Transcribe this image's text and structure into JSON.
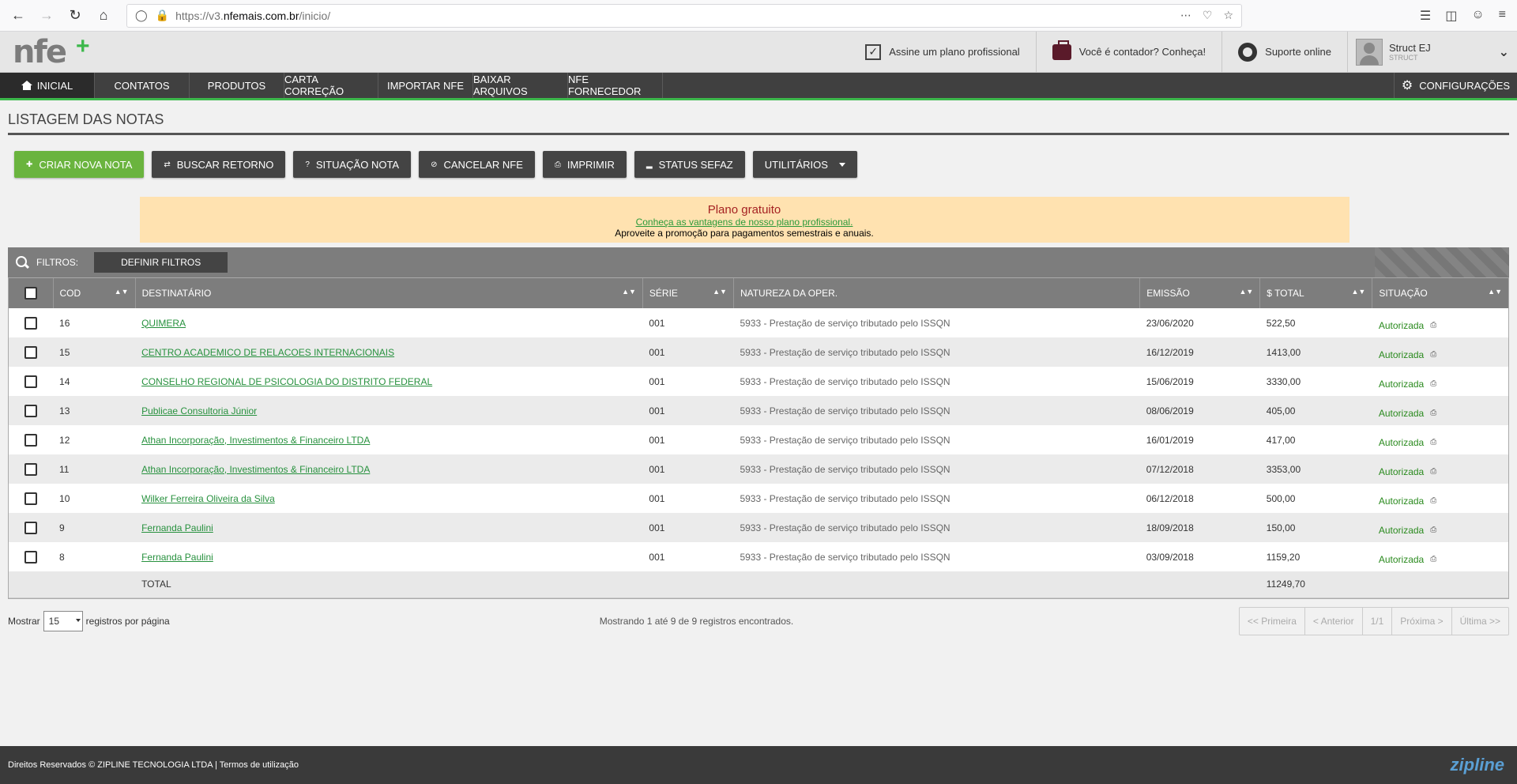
{
  "browser": {
    "url_prefix": "https://v3.",
    "url_domain": "nfemais.com.br",
    "url_path": "/inicio/"
  },
  "header": {
    "plan": "Assine um plano profissional",
    "accountant": "Você é contador? Conheça!",
    "support": "Suporte online",
    "user_name": "Struct EJ",
    "user_sub": "STRUCT"
  },
  "nav": {
    "items": [
      "INICIAL",
      "CONTATOS",
      "PRODUTOS",
      "CARTA CORREÇÃO",
      "IMPORTAR NFE",
      "BAIXAR ARQUIVOS",
      "NFE FORNECEDOR"
    ],
    "config": "CONFIGURAÇÕES"
  },
  "page_title": "LISTAGEM DAS NOTAS",
  "actions": {
    "create": "CRIAR NOVA NOTA",
    "fetch": "BUSCAR RETORNO",
    "status_note": "SITUAÇÃO NOTA",
    "cancel": "CANCELAR NFE",
    "print": "IMPRIMIR",
    "sefaz": "STATUS SEFAZ",
    "utils": "UTILITÁRIOS"
  },
  "promo": {
    "title": "Plano gratuito",
    "link": "Conheça as vantagens de nosso plano profissional.",
    "sub": "Aproveite a promoção para pagamentos semestrais e anuais."
  },
  "filters": {
    "label": "FILTROS:",
    "button": "DEFINIR FILTROS"
  },
  "table": {
    "headers": [
      "COD",
      "DESTINATÁRIO",
      "SÉRIE",
      "NATUREZA DA OPER.",
      "EMISSÃO",
      "$ TOTAL",
      "SITUAÇÃO"
    ],
    "rows": [
      {
        "cod": "16",
        "dest": "QUIMERA",
        "serie": "001",
        "natureza": "5933 - Prestação de serviço tributado pelo ISSQN",
        "emissao": "23/06/2020",
        "total": "522,50",
        "status": "Autorizada"
      },
      {
        "cod": "15",
        "dest": "CENTRO ACADEMICO DE RELACOES INTERNACIONAIS",
        "serie": "001",
        "natureza": "5933 - Prestação de serviço tributado pelo ISSQN",
        "emissao": "16/12/2019",
        "total": "1413,00",
        "status": "Autorizada"
      },
      {
        "cod": "14",
        "dest": "CONSELHO REGIONAL DE PSICOLOGIA DO DISTRITO FEDERAL",
        "serie": "001",
        "natureza": "5933 - Prestação de serviço tributado pelo ISSQN",
        "emissao": "15/06/2019",
        "total": "3330,00",
        "status": "Autorizada"
      },
      {
        "cod": "13",
        "dest": "Publicae Consultoria Júnior",
        "serie": "001",
        "natureza": "5933 - Prestação de serviço tributado pelo ISSQN",
        "emissao": "08/06/2019",
        "total": "405,00",
        "status": "Autorizada"
      },
      {
        "cod": "12",
        "dest": "Athan Incorporação, Investimentos & Financeiro LTDA",
        "serie": "001",
        "natureza": "5933 - Prestação de serviço tributado pelo ISSQN",
        "emissao": "16/01/2019",
        "total": "417,00",
        "status": "Autorizada"
      },
      {
        "cod": "11",
        "dest": "Athan Incorporação, Investimentos & Financeiro LTDA",
        "serie": "001",
        "natureza": "5933 - Prestação de serviço tributado pelo ISSQN",
        "emissao": "07/12/2018",
        "total": "3353,00",
        "status": "Autorizada"
      },
      {
        "cod": "10",
        "dest": "Wilker Ferreira Oliveira da Silva",
        "serie": "001",
        "natureza": "5933 - Prestação de serviço tributado pelo ISSQN",
        "emissao": "06/12/2018",
        "total": "500,00",
        "status": "Autorizada"
      },
      {
        "cod": "9",
        "dest": "Fernanda Paulini",
        "serie": "001",
        "natureza": "5933 - Prestação de serviço tributado pelo ISSQN",
        "emissao": "18/09/2018",
        "total": "150,00",
        "status": "Autorizada"
      },
      {
        "cod": "8",
        "dest": "Fernanda Paulini",
        "serie": "001",
        "natureza": "5933 - Prestação de serviço tributado pelo ISSQN",
        "emissao": "03/09/2018",
        "total": "1159,20",
        "status": "Autorizada"
      }
    ],
    "total_label": "TOTAL",
    "total_value": "11249,70"
  },
  "pager": {
    "show": "Mostrar",
    "per_page_value": "15",
    "per_page_suffix": "registros por página",
    "showing": "Mostrando 1 até 9 de 9 registros encontrados.",
    "first": "<< Primeira",
    "prev": "< Anterior",
    "current": "1/1",
    "next": "Próxima >",
    "last": "Última >>"
  },
  "footer": {
    "text": "Direitos Reservados © ZIPLINE TECNOLOGIA LTDA | Termos de utilização",
    "logo": "zipline"
  }
}
